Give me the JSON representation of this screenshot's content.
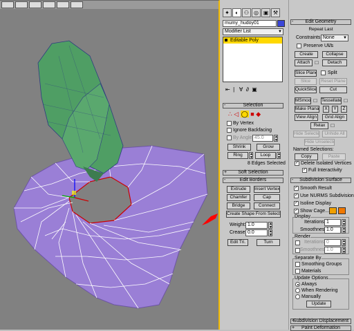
{
  "object_name": "mumy_hudoy01",
  "modifier_list_label": "Modifier List",
  "stack_item": "Editable Poly",
  "selection": {
    "title": "Selection",
    "by_vertex": "By Vertex",
    "ignore_backfacing": "Ignore Backfacing",
    "by_angle": "By Angle:",
    "angle_value": "45.0",
    "shrink": "Shrink",
    "grow": "Grow",
    "ring": "Ring",
    "loop": "Loop",
    "status": "8 Edges Selected"
  },
  "soft_selection": {
    "title": "Soft Selection"
  },
  "edit_borders": {
    "title": "Edit Borders",
    "extrude": "Extrude",
    "insert_vertex": "Insert Vertex",
    "chamfer": "Chamfer",
    "cap": "Cap",
    "bridge": "Bridge",
    "connect": "Connect",
    "create_shape": "Create Shape From Selection",
    "weight_label": "Weight:",
    "weight_value": "1.0",
    "crease_label": "Crease:",
    "crease_value": "0.0",
    "edit_tri": "Edit Tri.",
    "turn": "Turn"
  },
  "edit_geometry": {
    "title": "Edit Geometry",
    "repeat_last": "Repeat Last",
    "constraints_label": "Constraints:",
    "constraints_value": "None",
    "preserve_uvs": "Preserve UVs",
    "create": "Create",
    "collapse": "Collapse",
    "attach": "Attach",
    "detach": "Detach",
    "slice_plane": "Slice Plane",
    "split": "Split",
    "slice": "Slice",
    "reset_plane": "Reset Plane",
    "quickslice": "QuickSlice",
    "cut": "Cut",
    "msmooth": "MSmooth",
    "tessellate": "Tessellate",
    "make_planar": "Make Planar",
    "x": "X",
    "y": "Y",
    "z": "Z",
    "view_align": "View Align",
    "grid_align": "Grid Align",
    "relax": "Relax",
    "hide_selected": "Hide Selected",
    "unhide_all": "Unhide All",
    "hide_unselected": "Hide Unselected",
    "named_selections": "Named Selections:",
    "copy": "Copy",
    "paste": "Paste",
    "delete_isolated": "Delete Isolated Vertices",
    "full_interactivity": "Full Interactivity"
  },
  "subdivision_surface": {
    "title": "Subdivision Surface",
    "smooth_result": "Smooth Result",
    "use_nurms": "Use NURMS Subdivision",
    "isoline_display": "Isoline Display",
    "show_cage": "Show Cage......",
    "display_group": "Display",
    "iterations_label": "Iterations:",
    "display_iterations": "1",
    "smoothness_label": "Smoothness:",
    "display_smoothness": "1.0",
    "render_group": "Render",
    "render_iterations": "0",
    "render_smoothness": "1.0",
    "separate_by": "Separate By",
    "smoothing_groups": "Smoothing Groups",
    "materials": "Materials",
    "update_options": "Update Options",
    "always": "Always",
    "when_rendering": "When Rendering",
    "manually": "Manually",
    "update": "Update"
  },
  "subdivision_displacement": {
    "title": "Subdivision Displacement"
  },
  "paint_deformation": {
    "title": "Paint Deformation"
  },
  "colors": {
    "object_color": "#3a46d8",
    "cage_color_1": "#f0a000",
    "cage_color_2": "#f07800",
    "stack_highlight": "#ffd800",
    "viewport_border": "#f0b800"
  }
}
